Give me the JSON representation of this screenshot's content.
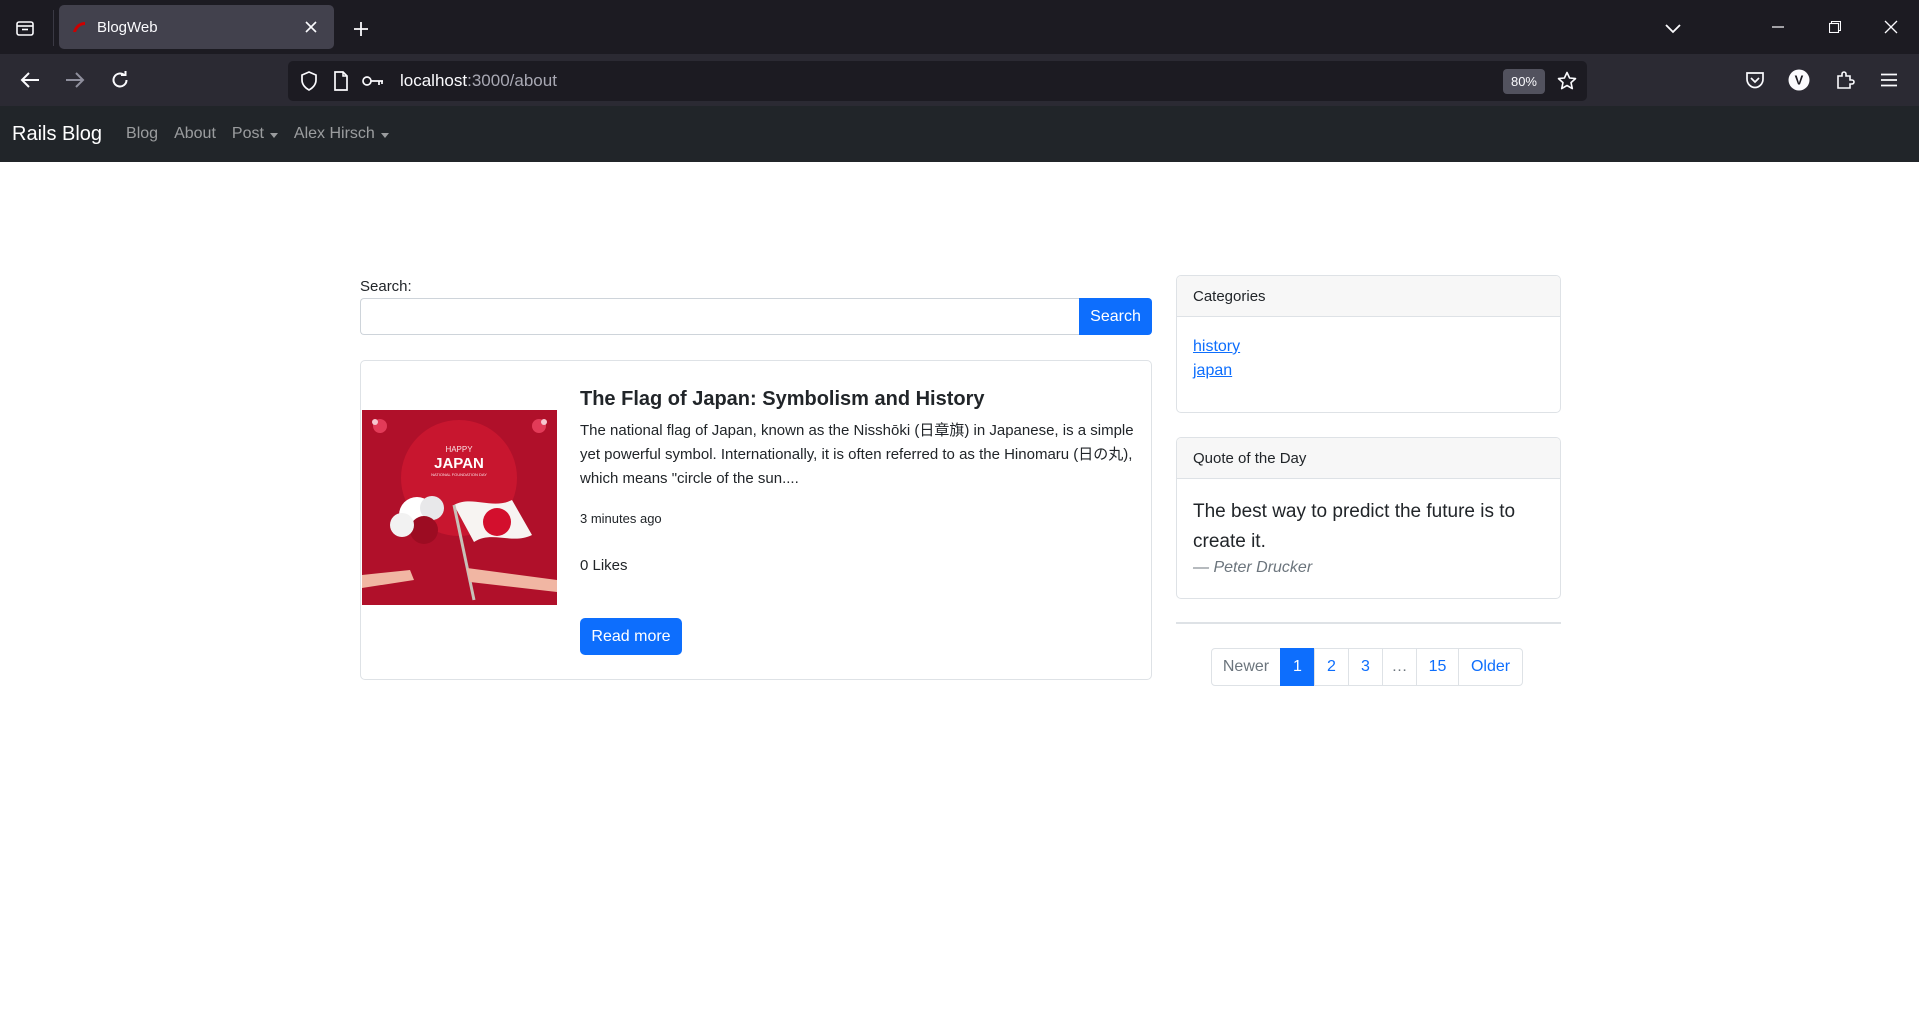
{
  "browser": {
    "tab_title": "BlogWeb",
    "url_host": "localhost",
    "url_rest": ":3000/about",
    "zoom": "80%"
  },
  "site_nav": {
    "brand": "Rails Blog",
    "links": [
      "Blog",
      "About",
      "Post",
      "Alex Hirsch"
    ]
  },
  "search": {
    "label": "Search:",
    "button": "Search",
    "value": ""
  },
  "post": {
    "title": "The Flag of Japan: Symbolism and History",
    "excerpt": "The national flag of Japan, known as the Nisshōki (日章旗) in Japanese, is a simple yet powerful symbol. Internationally, it is often referred to as the Hinomaru (日の丸), which means \"circle of the sun....",
    "time": "3 minutes ago",
    "likes": "0 Likes",
    "read_more": "Read more",
    "image_text_top": "HAPPY",
    "image_text_main": "JAPAN",
    "image_text_sub": "NATIONAL FOUNDATION DAY"
  },
  "categories": {
    "header": "Categories",
    "items": [
      "history",
      "japan"
    ]
  },
  "quote": {
    "header": "Quote of the Day",
    "text": "The best way to predict the future is to create it.",
    "author": "— Peter Drucker"
  },
  "pagination": {
    "newer": "Newer",
    "pages": [
      "1",
      "2",
      "3",
      "…",
      "15"
    ],
    "older": "Older",
    "active": "1"
  },
  "colors": {
    "primary": "#0d6efd",
    "navbar": "#212529",
    "chrome_dark": "#1c1b22"
  }
}
